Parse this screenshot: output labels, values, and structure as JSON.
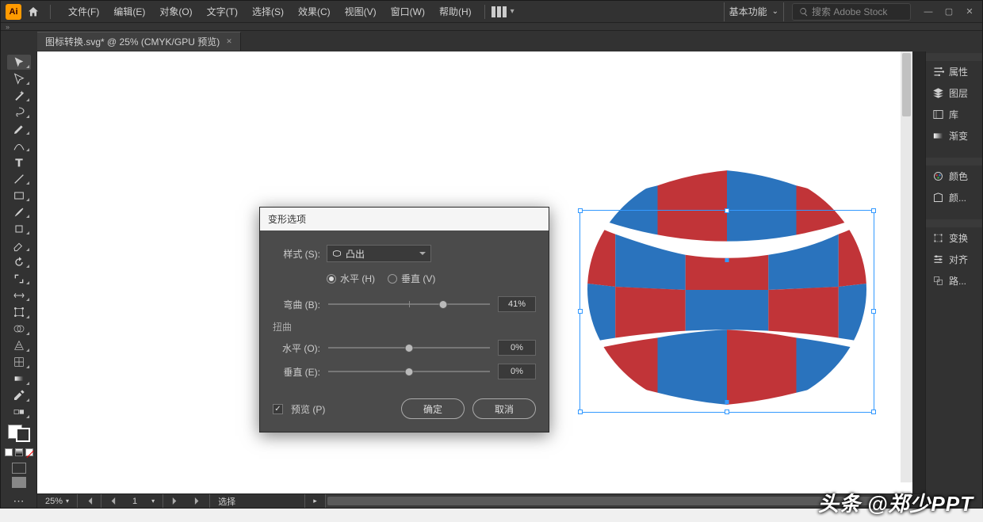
{
  "menubar": {
    "items": [
      "文件(F)",
      "编辑(E)",
      "对象(O)",
      "文字(T)",
      "选择(S)",
      "效果(C)",
      "视图(V)",
      "窗口(W)",
      "帮助(H)"
    ],
    "workspace_label": "基本功能",
    "search_placeholder": "搜索 Adobe Stock"
  },
  "tab": {
    "title": "图标转换.svg* @ 25% (CMYK/GPU 预览)"
  },
  "dialog": {
    "title": "变形选项",
    "style_label": "样式 (S):",
    "style_value": "凸出",
    "orient_h": "水平 (H)",
    "orient_v": "垂直 (V)",
    "bend_label": "弯曲 (B):",
    "bend_value": "41%",
    "distort_label": "扭曲",
    "horiz_label": "水平 (O):",
    "horiz_value": "0%",
    "vert_label": "垂直 (E):",
    "vert_value": "0%",
    "preview_label": "预览 (P)",
    "ok": "确定",
    "cancel": "取消",
    "slider_pos": {
      "bend": 71,
      "horiz": 50,
      "vert": 50
    }
  },
  "panels_right": [
    "属性",
    "图层",
    "库",
    "渐变",
    "颜色",
    "颜...",
    "变换",
    "对齐",
    "路..."
  ],
  "statusbar": {
    "zoom": "25%",
    "page": "1",
    "tool": "选择"
  },
  "watermark": "头条 @郑少PPT",
  "art": {
    "colors": {
      "red": "#c13438",
      "blue": "#2a73bd",
      "white": "#ffffff"
    }
  }
}
